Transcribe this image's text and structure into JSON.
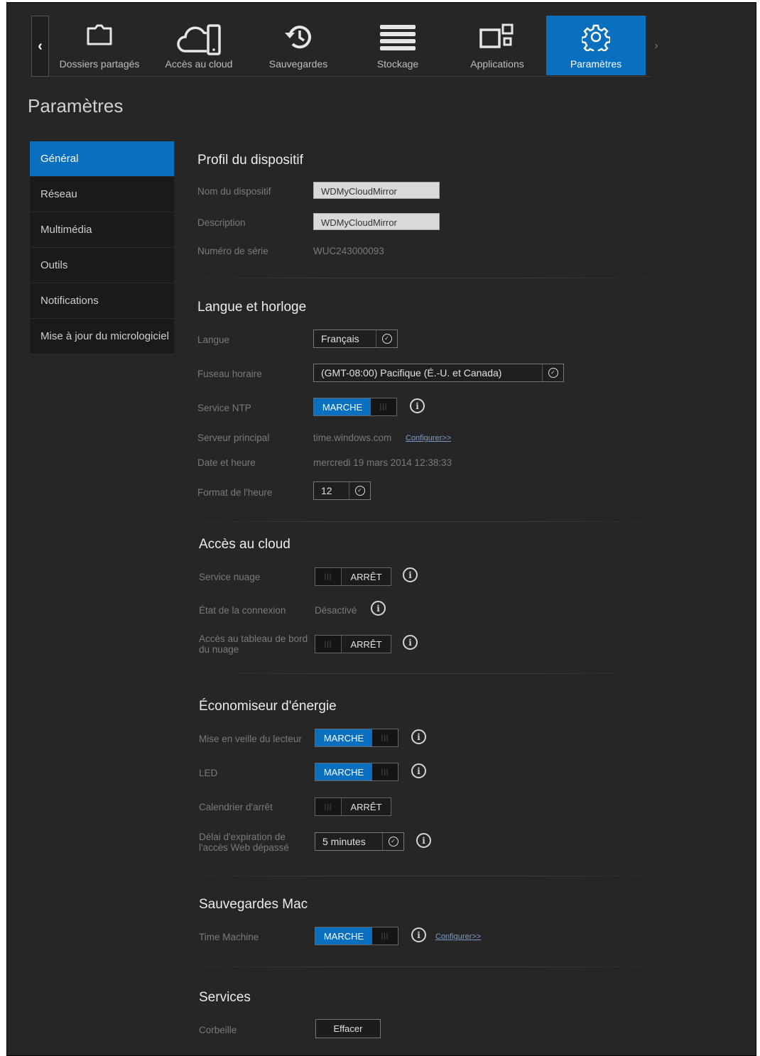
{
  "nav": {
    "items": [
      {
        "label": "Dossiers partagés",
        "icon": "folder-icon"
      },
      {
        "label": "Accès au cloud",
        "icon": "cloud-device-icon"
      },
      {
        "label": "Sauvegardes",
        "icon": "history-icon"
      },
      {
        "label": "Stockage",
        "icon": "storage-icon"
      },
      {
        "label": "Applications",
        "icon": "apps-icon"
      },
      {
        "label": "Paramètres",
        "icon": "gear-icon",
        "active": true
      }
    ],
    "left_arrow": "‹",
    "right_arrow": "›"
  },
  "page_title": "Paramètres",
  "sidebar": {
    "items": [
      {
        "label": "Général",
        "active": true
      },
      {
        "label": "Réseau"
      },
      {
        "label": "Multimédia"
      },
      {
        "label": "Outils"
      },
      {
        "label": "Notifications"
      },
      {
        "label": "Mise à jour du micrologiciel"
      }
    ]
  },
  "profile": {
    "title": "Profil du dispositif",
    "name_label": "Nom du dispositif",
    "name_value": "WDMyCloudMirror",
    "desc_label": "Description",
    "desc_value": "WDMyCloudMirror",
    "serial_label": "Numéro de série",
    "serial_value": "WUC243000093"
  },
  "lang": {
    "title": "Langue et horloge",
    "language_label": "Langue",
    "language_value": "Français",
    "tz_label": "Fuseau horaire",
    "tz_value": "(GMT-08:00) Pacifique (É.-U. et Canada)",
    "ntp_label": "Service NTP",
    "ntp_value": "MARCHE",
    "server_label": "Serveur principal",
    "server_value": "time.windows.com",
    "server_link": "Configurer>>",
    "date_label": "Date et heure",
    "date_value": "mercredi 19 mars 2014 12:38:33",
    "format_label": "Format de l'heure",
    "format_value": "12"
  },
  "cloud": {
    "title": "Accès au cloud",
    "service_label": "Service nuage",
    "service_value": "ARRÊT",
    "status_label": "État de la connexion",
    "status_value": "Désactivé",
    "dashboard_label": "Accès au tableau de bord du nuage",
    "dashboard_value": "ARRÊT"
  },
  "energy": {
    "title": "Économiseur d'énergie",
    "sleep_label": "Mise en veille du lecteur",
    "sleep_value": "MARCHE",
    "led_label": "LED",
    "led_value": "MARCHE",
    "schedule_label": "Calendrier d'arrêt",
    "schedule_value": "ARRÊT",
    "timeout_label": "Délai d'expiration de l'accès Web dépassé",
    "timeout_value": "5 minutes"
  },
  "mac": {
    "title": "Sauvegardes Mac",
    "tm_label": "Time Machine",
    "tm_value": "MARCHE",
    "tm_link": "Configurer>>"
  },
  "services": {
    "title": "Services",
    "trash_label": "Corbeille",
    "trash_button": "Effacer"
  },
  "toggle_grip": "|||",
  "info_glyph": "i",
  "chevron_glyph": "✓",
  "colors": {
    "accent": "#0a6fbf",
    "background": "#262626",
    "sidebar": "#1a1a1a"
  }
}
